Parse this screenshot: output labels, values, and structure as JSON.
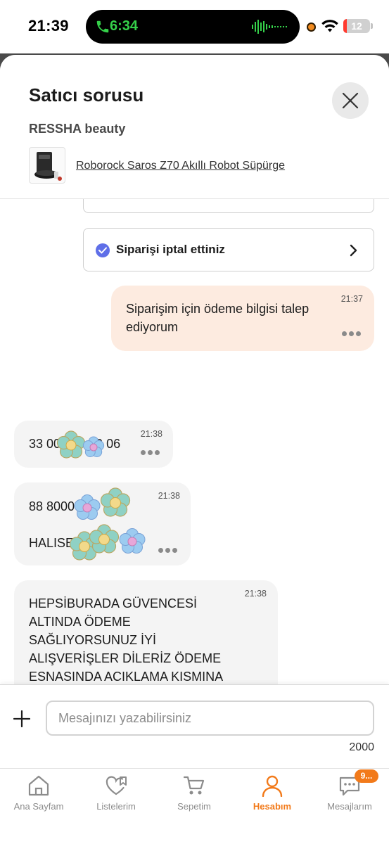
{
  "status_bar": {
    "time": "21:39",
    "call_time": "6:34",
    "battery": "12",
    "battery_level": 0.12
  },
  "sheet": {
    "title": "Satıcı sorusu",
    "seller": "RESSHA beauty",
    "product_name": "Roborock Saros Z70 Akıllı Robot Süpürge"
  },
  "chat": {
    "status_cards": [
      {
        "text": ""
      },
      {
        "text": "Siparişi iptal ettiniz"
      }
    ],
    "messages": [
      {
        "direction": "out",
        "time": "21:37",
        "text": "Siparişim için ödeme bilgisi talep ediyorum"
      },
      {
        "direction": "in",
        "time": "21:38",
        "text": "33 00          0 06"
      },
      {
        "direction": "in",
        "time": "21:38",
        "line1": "88 8000",
        "line2": "HALISE"
      },
      {
        "direction": "in",
        "time": "21:38",
        "text": "HEPSİBURADA GÜVENCESİ ALTINDA ÖDEME SAĞLIYORSUNUZ İYİ ALIŞVERİŞLER DİLERİZ ÖDEME ESNASINDA ACIKLAMA KISMINA SİPARİŞ NO İSTEMEYİ UNUTMAYINIZ"
      }
    ]
  },
  "composer": {
    "placeholder": "Mesajınızı yazabilirsiniz",
    "value": "",
    "char_limit": "2000"
  },
  "bottom_nav": {
    "items": [
      {
        "label": "Ana Sayfam",
        "icon": "home-icon"
      },
      {
        "label": "Listelerim",
        "icon": "heart-list-icon"
      },
      {
        "label": "Sepetim",
        "icon": "cart-icon"
      },
      {
        "label": "Hesabım",
        "icon": "account-icon",
        "active": true
      },
      {
        "label": "Mesajlarım",
        "icon": "messages-icon",
        "badge": "9..."
      }
    ]
  },
  "colors": {
    "accent": "#f27a1a",
    "outgoing_bubble": "#fdebe0",
    "incoming_bubble": "#f4f4f4",
    "status_check": "#5f6fe8",
    "call_green": "#35d14a"
  }
}
